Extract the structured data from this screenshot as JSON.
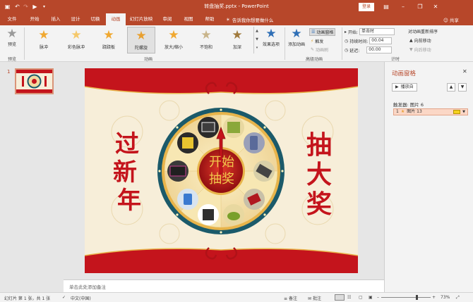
{
  "titlebar": {
    "title": "转盘抽奖.pptx - PowerPoint",
    "login_label": "登录",
    "icons": [
      "save-icon",
      "undo-icon",
      "redo-icon",
      "start-from-beginning-icon",
      "customize-qat-icon"
    ]
  },
  "tabs": [
    {
      "label": "文件"
    },
    {
      "label": "开始"
    },
    {
      "label": "插入"
    },
    {
      "label": "设计"
    },
    {
      "label": "切换"
    },
    {
      "label": "动画"
    },
    {
      "label": "幻灯片放映"
    },
    {
      "label": "审阅"
    },
    {
      "label": "视图"
    },
    {
      "label": "帮助"
    }
  ],
  "tell_me": {
    "label": "告诉我你想要做什么"
  },
  "share": {
    "label": "共享"
  },
  "ribbon": {
    "preview": {
      "label": "预览",
      "group_label": "预览"
    },
    "animation_group_label": "动画",
    "animations": [
      {
        "label": "脉冲",
        "color": "#f0a830"
      },
      {
        "label": "彩色脉冲",
        "color": "#f5c86a"
      },
      {
        "label": "跷跷板",
        "color": "#f0a830"
      },
      {
        "label": "陀螺旋",
        "color": "#e8a030"
      },
      {
        "label": "放大/缩小",
        "color": "#f0a830"
      },
      {
        "label": "不饱和",
        "color": "#c8b48a"
      },
      {
        "label": "加深",
        "color": "#a07a3c"
      }
    ],
    "effect_options": {
      "label": "效果选项"
    },
    "advanced": {
      "group_label": "高级动画",
      "add_animation": "添加动画",
      "animation_pane": "动画窗格",
      "trigger": "触发",
      "animation_painter": "动画刷"
    },
    "timing": {
      "group_label": "计时",
      "start_label": "开始:",
      "start_value": "单击时",
      "duration_label": "持续时间:",
      "duration_value": "00.04",
      "delay_label": "延迟:",
      "delay_value": "00.00",
      "reorder_label": "对动画重新排序",
      "move_earlier": "向前移动",
      "move_later": "向后移动"
    }
  },
  "slides_pane": {
    "slide_number": "1"
  },
  "slide": {
    "left_text": [
      "过",
      "新",
      "年"
    ],
    "right_text": [
      "抽",
      "大",
      "奖"
    ],
    "center_text": [
      [
        "开",
        "始"
      ],
      [
        "抽",
        "奖"
      ]
    ],
    "colors": {
      "red": "#c4141c",
      "gold": "#e8b44a",
      "wheel": "#1b5a6a"
    }
  },
  "notes": {
    "placeholder": "单击此处添加备注"
  },
  "animation_pane": {
    "title": "动画窗格",
    "play_label": "播放自",
    "trigger_label": "触发器: 图片 6",
    "item_index": "1",
    "item_label": "图片 13"
  },
  "status": {
    "slide_info": "幻灯片 第 1 张，共 1 张",
    "language": "中文(中国)",
    "notes_label": "备注",
    "comments_label": "批注",
    "zoom": "73%"
  }
}
